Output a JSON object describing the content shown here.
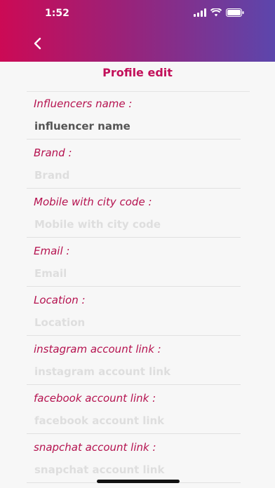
{
  "status_bar": {
    "time": "1:52"
  },
  "header": {
    "back_icon": "chevron-left-icon"
  },
  "page": {
    "title": "Profile edit"
  },
  "fields": [
    {
      "label": "Influencers name :",
      "value": "influencer name",
      "placeholder": "Influencers name"
    },
    {
      "label": "Brand :",
      "value": "",
      "placeholder": "Brand"
    },
    {
      "label": "Mobile with city code :",
      "value": "",
      "placeholder": "Mobile with city code"
    },
    {
      "label": "Email :",
      "value": "",
      "placeholder": "Email"
    },
    {
      "label": "Location :",
      "value": "",
      "placeholder": "Location"
    },
    {
      "label": "instagram account link :",
      "value": "",
      "placeholder": "instagram account link"
    },
    {
      "label": "facebook account link :",
      "value": "",
      "placeholder": "facebook account link"
    },
    {
      "label": "snapchat account link :",
      "value": "",
      "placeholder": "snapchat account link"
    }
  ],
  "colors": {
    "gradient_start": "#cc0a55",
    "gradient_end": "#5c46ac",
    "accent": "#c2105a"
  }
}
